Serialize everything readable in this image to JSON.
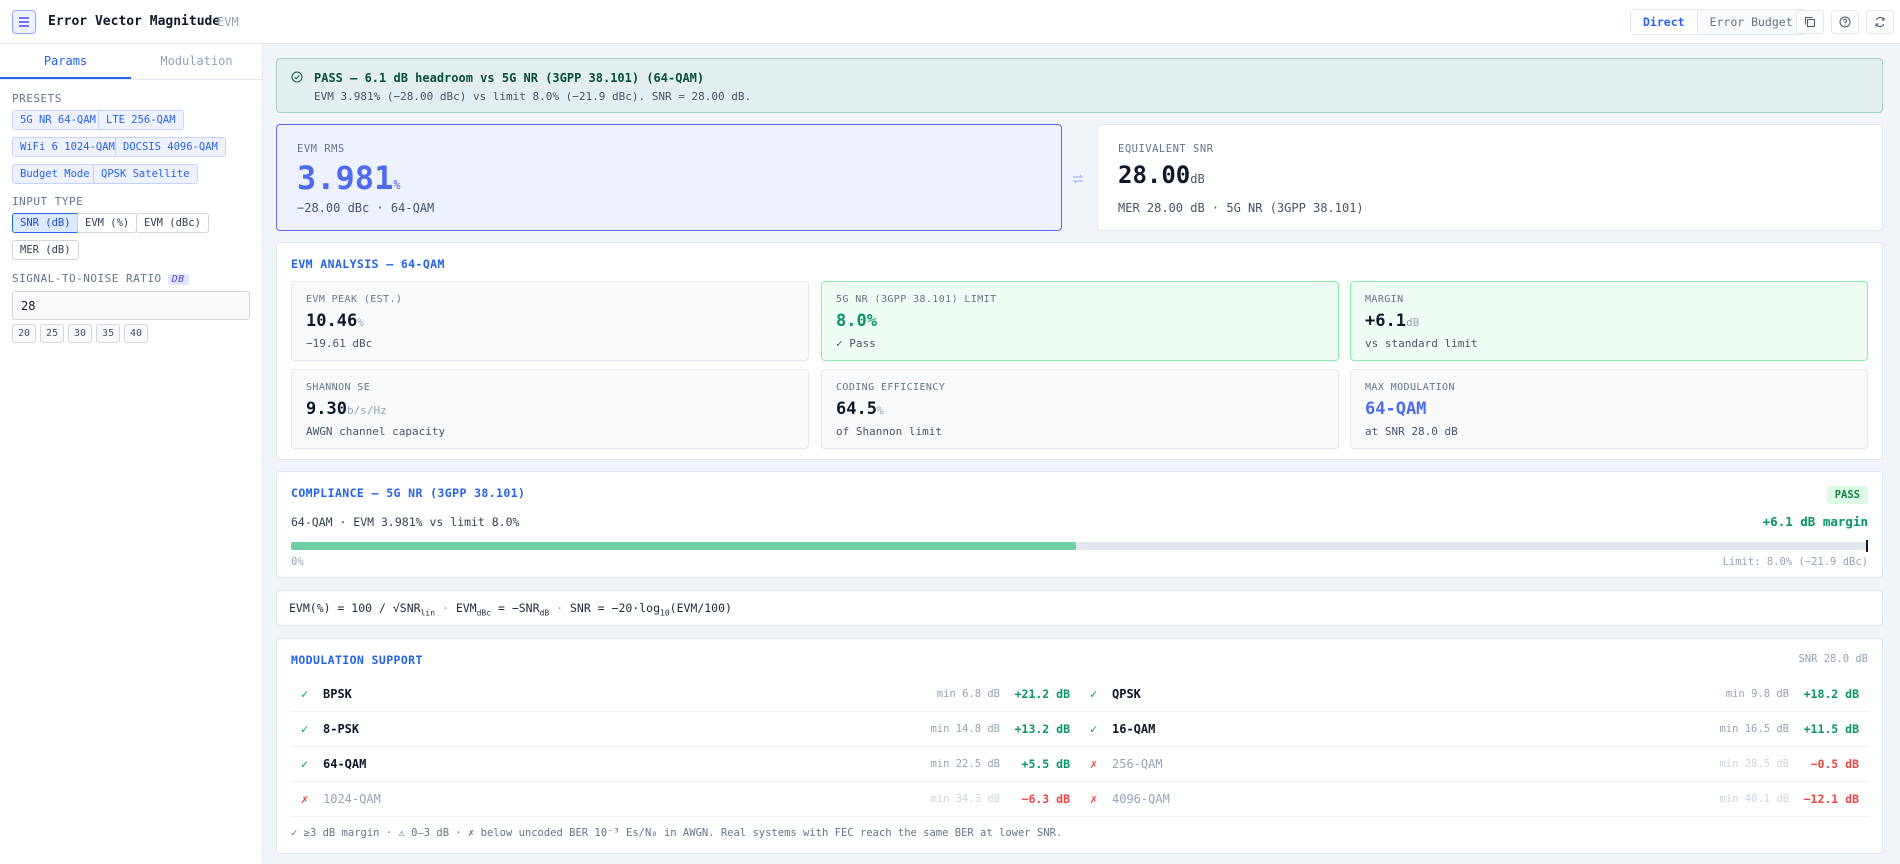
{
  "header": {
    "title": "Error Vector Magnitude",
    "abbr": "EVM",
    "modes": [
      "Direct",
      "Error Budget"
    ]
  },
  "sidebar": {
    "tabs": [
      "Params",
      "Modulation"
    ],
    "presets_label": "PRESETS",
    "presets": [
      "5G NR 64-QAM",
      "LTE 256-QAM",
      "WiFi 6 1024-QAM",
      "DOCSIS 4096-QAM",
      "Budget Mode",
      "QPSK Satellite"
    ],
    "input_type_label": "INPUT TYPE",
    "input_types": [
      "SNR (dB)",
      "EVM (%)",
      "EVM (dBc)",
      "MER (dB)"
    ],
    "snr_label": "SIGNAL-TO-NOISE RATIO",
    "snr_unit": "DB",
    "snr_value": "28",
    "quick_values": [
      "20",
      "25",
      "30",
      "35",
      "40"
    ]
  },
  "banner": {
    "title": "PASS — 6.1 dB headroom vs 5G NR (3GPP 38.101) (64-QAM)",
    "subtitle": "EVM 3.981% (−28.00 dBc) vs limit 8.0% (−21.9 dBc). SNR = 28.00 dB."
  },
  "evm_rms": {
    "label": "EVM RMS",
    "value": "3.981",
    "unit": "%",
    "sub": "−28.00 dBc · 64-QAM"
  },
  "equiv_snr": {
    "label": "EQUIVALENT SNR",
    "value": "28.00",
    "unit": "dB",
    "sub": "MER 28.00 dB · 5G NR (3GPP 38.101)"
  },
  "analysis": {
    "title": "EVM ANALYSIS — 64-QAM",
    "cards": [
      {
        "label": "EVM PEAK (EST.)",
        "value": "10.46",
        "unit": "%",
        "sub": "−19.61 dBc"
      },
      {
        "label": "5G NR (3GPP 38.101) LIMIT",
        "value": "8.0%",
        "unit": "",
        "sub": "✓ Pass"
      },
      {
        "label": "MARGIN",
        "value": "+6.1",
        "unit": "dB",
        "sub": "vs standard limit"
      },
      {
        "label": "SHANNON SE",
        "value": "9.30",
        "unit": "b/s/Hz",
        "sub": "AWGN channel capacity"
      },
      {
        "label": "CODING EFFICIENCY",
        "value": "64.5",
        "unit": "%",
        "sub": "of Shannon limit"
      },
      {
        "label": "MAX MODULATION",
        "value": "64-QAM",
        "unit": "",
        "sub": "at SNR 28.0 dB"
      }
    ]
  },
  "compliance": {
    "title": "COMPLIANCE — 5G NR (3GPP 38.101)",
    "badge": "PASS",
    "detail": "64-QAM · EVM 3.981% vs limit 8.0%",
    "margin": "+6.1 dB margin",
    "bar_fraction": 0.498,
    "min_label": "0%",
    "limit_label": "Limit: 8.0% (−21.9 dBc)"
  },
  "formula": {
    "f1": "EVM(%) = 100 / √SNR",
    "f1_sub": "lin",
    "sep": "·",
    "f2": "EVM",
    "f2_sub": "dBc",
    "f2_rest": " = −SNR",
    "f2_sub2": "dB",
    "f3": "SNR = −20·log",
    "f3_sub": "10",
    "f3_rest": "(EVM/100)"
  },
  "modulation": {
    "title": "MODULATION SUPPORT",
    "snr_note": "SNR 28.0 dB",
    "rows": [
      {
        "name": "BPSK",
        "min": "min 6.8 dB",
        "margin": "+21.2 dB",
        "ok": true,
        "mark": "✓"
      },
      {
        "name": "QPSK",
        "min": "min 9.8 dB",
        "margin": "+18.2 dB",
        "ok": true,
        "mark": "✓"
      },
      {
        "name": "8-PSK",
        "min": "min 14.8 dB",
        "margin": "+13.2 dB",
        "ok": true,
        "mark": "✓"
      },
      {
        "name": "16-QAM",
        "min": "min 16.5 dB",
        "margin": "+11.5 dB",
        "ok": true,
        "mark": "✓"
      },
      {
        "name": "64-QAM",
        "min": "min 22.5 dB",
        "margin": "+5.5 dB",
        "ok": true,
        "mark": "✓"
      },
      {
        "name": "256-QAM",
        "min": "min 28.5 dB",
        "margin": "−0.5 dB",
        "ok": false,
        "mark": "✗"
      },
      {
        "name": "1024-QAM",
        "min": "min 34.3 dB",
        "margin": "−6.3 dB",
        "ok": false,
        "mark": "✗"
      },
      {
        "name": "4096-QAM",
        "min": "min 40.1 dB",
        "margin": "−12.1 dB",
        "ok": false,
        "mark": "✗"
      }
    ],
    "footnote": "✓ ≥3 dB margin  ·  ⚠ 0–3 dB  ·  ✗ below uncoded BER 10⁻³ Es/N₀ in AWGN. Real systems with FEC reach the same BER at lower SNR."
  },
  "colors": {
    "accent": "#2563eb",
    "pass": "#059669",
    "fail": "#ef4444",
    "bar": "#6fcea4"
  }
}
